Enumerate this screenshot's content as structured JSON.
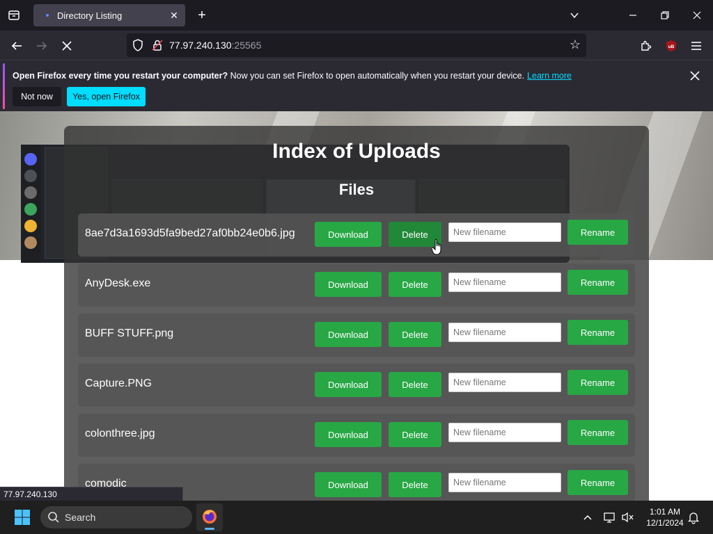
{
  "browser": {
    "tab_title": "Directory Listing",
    "url_host": "77.97.240.130",
    "url_port": ":25565",
    "extension_badge": "uB"
  },
  "notification": {
    "bold_text": "Open Firefox every time you restart your computer?",
    "text": "Now you can set Firefox to open automatically when you restart your device.",
    "link": "Learn more",
    "not_now": "Not now",
    "yes": "Yes, open Firefox"
  },
  "page": {
    "title": "Index of Uploads",
    "subtitle": "Files",
    "download_label": "Download",
    "delete_label": "Delete",
    "rename_label": "Rename",
    "input_placeholder": "New filename",
    "files": [
      "8ae7d3a1693d5fa9bed27af0bb24e0b6.jpg",
      "AnyDesk.exe",
      "BUFF STUFF.png",
      "Capture.PNG",
      "colonthree.jpg",
      "comodic"
    ]
  },
  "status_link": "77.97.240.130",
  "taskbar": {
    "search_label": "Search",
    "time": "1:01 AM",
    "date": "12/1/2024"
  }
}
